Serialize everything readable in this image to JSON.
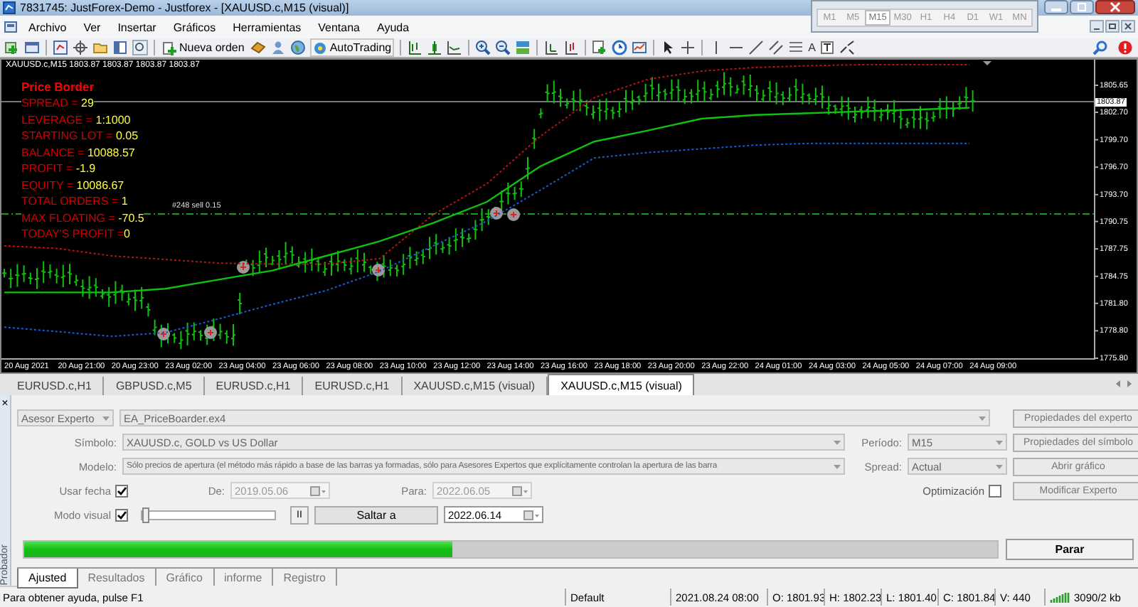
{
  "window": {
    "title": "7831745: JustForex-Demo - Justforex - [XAUUSD.c,M15 (visual)]"
  },
  "timeframes": [
    {
      "label": "M1",
      "selected": false
    },
    {
      "label": "M5",
      "selected": false
    },
    {
      "label": "M15",
      "selected": true
    },
    {
      "label": "M30",
      "selected": false
    },
    {
      "label": "H1",
      "selected": false
    },
    {
      "label": "H4",
      "selected": false
    },
    {
      "label": "D1",
      "selected": false
    },
    {
      "label": "W1",
      "selected": false
    },
    {
      "label": "MN",
      "selected": false
    }
  ],
  "menu": [
    "Archivo",
    "Ver",
    "Insertar",
    "Gráficos",
    "Herramientas",
    "Ventana",
    "Ayuda"
  ],
  "toolbar": {
    "new_order": "Nueva orden",
    "autotrading": "AutoTrading",
    "text_tool": "A"
  },
  "chart": {
    "header": "XAUUSD.c,M15 1803.87 1803.87 1803.87 1803.87",
    "info_title": "Price Border",
    "current_price": "1803.87",
    "order_label": "#248 sell 0.15",
    "info_rows": [
      {
        "label": "SPREAD = ",
        "value": "29"
      },
      {
        "label": "LEVERAGE = ",
        "value": "1:1000"
      },
      {
        "label": "STARTING LOT = ",
        "value": "0.05"
      },
      {
        "label": "BALANCE = ",
        "value": "10088.57"
      },
      {
        "label": "PROFIT = ",
        "value": "-1.9"
      },
      {
        "label": "EQUITY = ",
        "value": "10086.67"
      },
      {
        "label": "TOTAL ORDERS = ",
        "value": "1"
      },
      {
        "label": "MAX FLOATING = ",
        "value": "-70.5"
      },
      {
        "label": "TODAY'S PROFIT =",
        "value": "0"
      }
    ],
    "chart_data": {
      "type": "line",
      "ylim": [
        1775.8,
        1808.45
      ],
      "categories": [
        "20 Aug 2021",
        "20 Aug 21:00",
        "20 Aug 23:00",
        "23 Aug 02:00",
        "23 Aug 04:00",
        "23 Aug 06:00",
        "23 Aug 08:00",
        "23 Aug 10:00",
        "23 Aug 12:00",
        "23 Aug 14:00",
        "23 Aug 16:00",
        "23 Aug 18:00",
        "23 Aug 20:00",
        "23 Aug 22:00",
        "24 Aug 01:00",
        "24 Aug 03:00",
        "24 Aug 05:00",
        "24 Aug 07:00",
        "24 Aug 09:00"
      ],
      "yticks": [
        {
          "value": 1805.65,
          "label": "1805.65"
        },
        {
          "value": 1802.7,
          "label": "1802.70"
        },
        {
          "value": 1799.7,
          "label": "1799.70"
        },
        {
          "value": 1796.7,
          "label": "1796.70"
        },
        {
          "value": 1793.7,
          "label": "1793.70"
        },
        {
          "value": 1790.75,
          "label": "1790.75"
        },
        {
          "value": 1787.75,
          "label": "1787.75"
        },
        {
          "value": 1784.75,
          "label": "1784.75"
        },
        {
          "value": 1781.8,
          "label": "1781.80"
        },
        {
          "value": 1778.8,
          "label": "1778.80"
        },
        {
          "value": 1775.8,
          "label": "1775.80"
        }
      ],
      "series": [
        {
          "color": "#c01010",
          "line_style": "dotted",
          "values": [
            1788.1,
            1787.8,
            1787.0,
            1786.6,
            1786.2,
            1786.1,
            1786.1,
            1786.7,
            1791.5,
            1794.9,
            1800.1,
            1804.3,
            1806.3,
            1807.2,
            1807.6,
            1807.8,
            1807.9,
            1807.9,
            1807.9
          ]
        },
        {
          "color": "#10c010",
          "line_style": "solid",
          "values": [
            1783.0,
            1783.0,
            1783.0,
            1783.4,
            1784.4,
            1785.4,
            1787.0,
            1788.6,
            1790.6,
            1792.9,
            1796.8,
            1799.5,
            1800.7,
            1802.0,
            1802.4,
            1802.6,
            1802.8,
            1803.0,
            1803.2
          ]
        },
        {
          "color": "#1a5ad0",
          "line_style": "dotted",
          "values": [
            1779.2,
            1778.7,
            1778.2,
            1778.6,
            1780.1,
            1781.7,
            1783.2,
            1785.3,
            1788.1,
            1790.8,
            1794.2,
            1797.7,
            1798.3,
            1798.7,
            1799.1,
            1799.3,
            1799.3,
            1799.3,
            1799.3
          ]
        }
      ]
    }
  },
  "chart_tabs": [
    {
      "label": "EURUSD.c,H1",
      "selected": false
    },
    {
      "label": "GBPUSD.c,M5",
      "selected": false
    },
    {
      "label": "EURUSD.c,H1",
      "selected": false
    },
    {
      "label": "EURUSD.c,H1",
      "selected": false
    },
    {
      "label": "XAUUSD.c,M15 (visual)",
      "selected": false
    },
    {
      "label": "XAUUSD.c,M15 (visual)",
      "selected": true
    }
  ],
  "tester": {
    "close": "×",
    "side_label": "Probador",
    "expert_type": "Asesor Experto",
    "expert_file": "EA_PriceBoarder.ex4",
    "symbol": {
      "label": "Símbolo:",
      "value": "XAUUSD.c, GOLD vs US Dollar"
    },
    "model": {
      "label": "Modelo:",
      "value": "Sólo precios de apertura (el método más rápido a base de las barras ya formadas, sólo para Asesores Expertos que explícitamente controlan la apertura de las barra"
    },
    "period": {
      "label": "Período:",
      "value": "M15"
    },
    "spread": {
      "label": "Spread:",
      "value": "Actual"
    },
    "use_date": {
      "label": "Usar fecha",
      "checked": true
    },
    "from": {
      "label": "De:",
      "value": "2019.05.06",
      "disabled": true
    },
    "to": {
      "label": "Para:",
      "value": "2022.06.05",
      "disabled": true
    },
    "optimization": {
      "label": "Optimización",
      "checked": false
    },
    "visual_mode": {
      "label": "Modo visual",
      "checked": true,
      "level": 0
    },
    "pause": "II",
    "skip_to": "Saltar a",
    "skip_date": "2022.06.14",
    "buttons": [
      "Propiedades del experto",
      "Propiedades del símbolo",
      "Abrir gráfico",
      "Modificar Experto"
    ],
    "progress": {
      "level": 0.44
    },
    "stop": "Parar"
  },
  "tester_tabs": [
    {
      "label": "Ajusted",
      "selected": true
    },
    {
      "label": "Resultados",
      "selected": false
    },
    {
      "label": "Gráfico",
      "selected": false
    },
    {
      "label": "informe",
      "selected": false
    },
    {
      "label": "Registro",
      "selected": false
    }
  ],
  "status_bar": {
    "help": "Para obtener ayuda, pulse F1",
    "profile": "Default",
    "time": "2021.08.24 08:00",
    "open": "O: 1801.93",
    "high": "H: 1802.23",
    "low": "L: 1801.40",
    "close": "C: 1801.84",
    "volume": "V: 440",
    "traffic": "3090/2 kb"
  }
}
